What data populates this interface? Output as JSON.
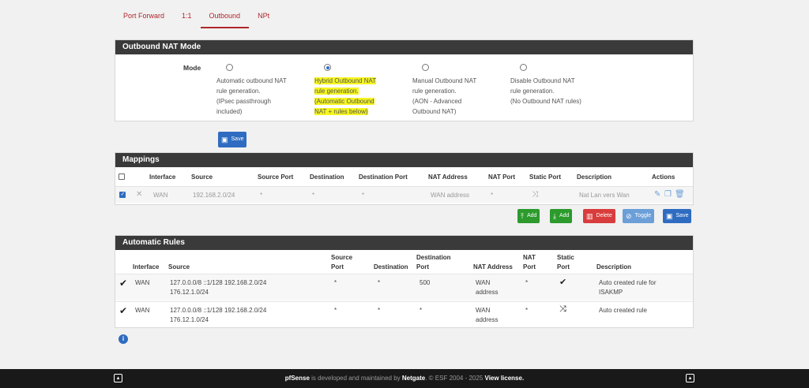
{
  "tabs": [
    {
      "label": "Port Forward"
    },
    {
      "label": "1:1"
    },
    {
      "label": "Outbound"
    },
    {
      "label": "NPt"
    }
  ],
  "nat_mode": {
    "title": "Outbound NAT Mode",
    "label": "Mode",
    "options": [
      {
        "text": "Automatic outbound NAT\nrule generation.\n(IPsec passthrough\nincluded)",
        "selected": false
      },
      {
        "text": "Hybrid Outbound NAT\nrule generation.\n(Automatic Outbound\nNAT + rules below)",
        "selected": true
      },
      {
        "text": "Manual Outbound NAT\nrule generation.\n(AON - Advanced\nOutbound NAT)",
        "selected": false
      },
      {
        "text": "Disable Outbound NAT\nrule generation.\n(No Outbound NAT rules)",
        "selected": false
      }
    ],
    "save_label": "Save"
  },
  "mappings": {
    "title": "Mappings",
    "headers": [
      "Interface",
      "Source",
      "Source Port",
      "Destination",
      "Destination Port",
      "NAT Address",
      "NAT Port",
      "Static Port",
      "Description",
      "Actions"
    ],
    "rows": [
      {
        "interface": "WAN",
        "source": "192.168.2.0/24",
        "source_port": "*",
        "destination": "*",
        "destination_port": "*",
        "nat_address": "WAN address",
        "nat_port": "*",
        "description": "Nat Lan vers Wan"
      }
    ],
    "buttons": {
      "add_top": "Add",
      "add_bottom": "Add",
      "delete": "Delete",
      "toggle": "Toggle",
      "save": "Save"
    }
  },
  "auto_rules": {
    "title": "Automatic Rules",
    "headers": {
      "interface": "Interface",
      "source": "Source",
      "source_port": "Source\nPort",
      "destination": "Destination",
      "destination_port": "Destination\nPort",
      "nat_address": "NAT Address",
      "nat_port": "NAT\nPort",
      "static_port": "Static\nPort",
      "description": "Description"
    },
    "rows": [
      {
        "interface": "WAN",
        "source": "127.0.0.0/8 ::1/128 192.168.2.0/24\n176.12.1.0/24",
        "source_port": "*",
        "destination": "*",
        "destination_port": "500",
        "nat_address": "WAN\naddress",
        "nat_port": "*",
        "description": "Auto created rule for\nISAKMP"
      },
      {
        "interface": "WAN",
        "source": "127.0.0.0/8 ::1/128 192.168.2.0/24\n176.12.1.0/24",
        "source_port": "*",
        "destination": "*",
        "destination_port": "*",
        "nat_address": "WAN\naddress",
        "nat_port": "*",
        "description": "Auto created rule"
      }
    ]
  },
  "footer": {
    "brand": "pfSense",
    "middle": " is developed and maintained by ",
    "company": "Netgate",
    "copy": ". © ESF 2004 - 2025 ",
    "license": "View license."
  }
}
